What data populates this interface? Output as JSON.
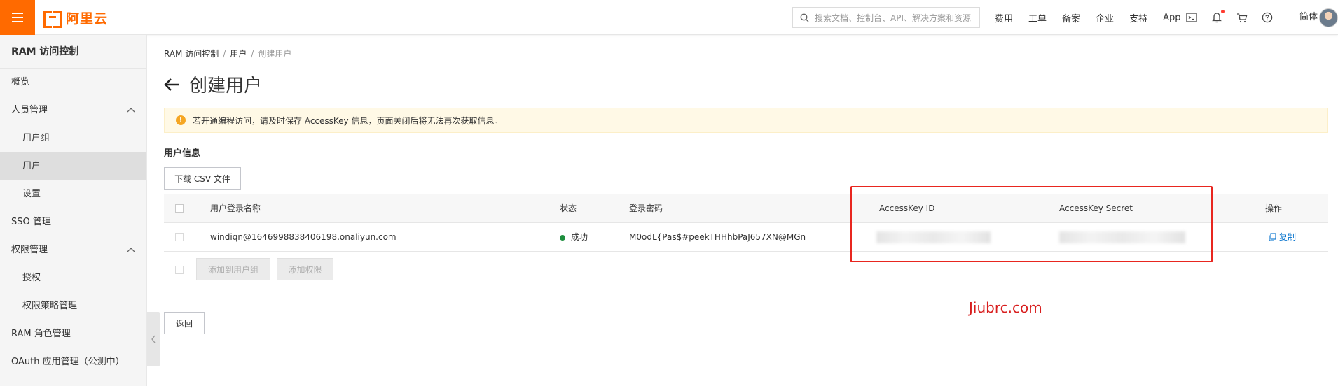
{
  "topbar": {
    "logo_text": "阿里云",
    "search_placeholder": "搜索文档、控制台、API、解决方案和资源",
    "links": [
      "费用",
      "工单",
      "备案",
      "企业",
      "支持",
      "App"
    ],
    "icons": [
      "terminal-icon",
      "bell-icon",
      "cart-icon",
      "help-icon"
    ],
    "lang": "简体",
    "brand_color": "#ff6a00"
  },
  "sidebar": {
    "title": "RAM 访问控制",
    "items": [
      {
        "label": "概览",
        "sub": false,
        "active": false,
        "chevron": false
      },
      {
        "label": "人员管理",
        "sub": false,
        "active": false,
        "chevron": true
      },
      {
        "label": "用户组",
        "sub": true,
        "active": false,
        "chevron": false
      },
      {
        "label": "用户",
        "sub": true,
        "active": true,
        "chevron": false
      },
      {
        "label": "设置",
        "sub": true,
        "active": false,
        "chevron": false
      },
      {
        "label": "SSO 管理",
        "sub": false,
        "active": false,
        "chevron": false
      },
      {
        "label": "权限管理",
        "sub": false,
        "active": false,
        "chevron": true
      },
      {
        "label": "授权",
        "sub": true,
        "active": false,
        "chevron": false
      },
      {
        "label": "权限策略管理",
        "sub": true,
        "active": false,
        "chevron": false
      },
      {
        "label": "RAM 角色管理",
        "sub": false,
        "active": false,
        "chevron": false
      },
      {
        "label": "OAuth 应用管理（公测中）",
        "sub": false,
        "active": false,
        "chevron": false
      }
    ]
  },
  "breadcrumb": {
    "items": [
      "RAM 访问控制",
      "用户"
    ],
    "current": "创建用户"
  },
  "page": {
    "title": "创建用户",
    "notice": "若开通编程访问，请及时保存 AccessKey 信息，页面关闭后将无法再次获取信息。",
    "section_title": "用户信息",
    "download_csv": "下载 CSV 文件",
    "add_to_group": "添加到用户组",
    "add_permission": "添加权限",
    "back": "返回"
  },
  "table": {
    "headers": {
      "login_name": "用户登录名称",
      "status": "状态",
      "password": "登录密码",
      "access_key_id": "AccessKey ID",
      "access_key_secret": "AccessKey Secret",
      "action": "操作"
    },
    "row": {
      "login_name": "windiqn@1646998838406198.onaliyun.com",
      "status": "成功",
      "password": "M0odL{Pas$#peekTHHhbPaJ657XN@MGn",
      "action": "复制",
      "status_color": "#1e8e3e"
    }
  },
  "watermark": "Jiubrc.com",
  "highlight_color": "#e8261f"
}
